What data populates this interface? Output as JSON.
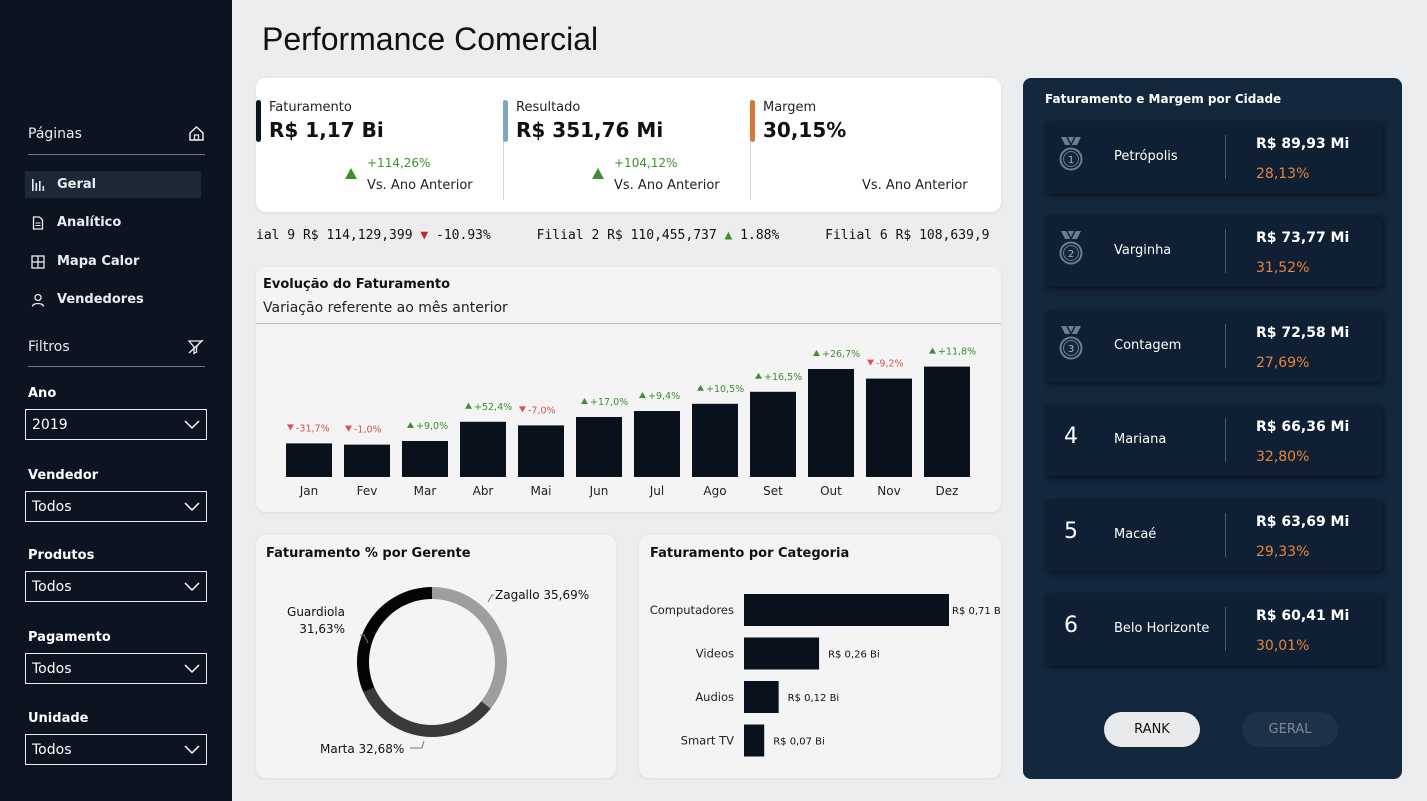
{
  "sidebar": {
    "pages_label": "Páginas",
    "nav": [
      {
        "label": "Geral",
        "icon": "bar-chart-icon"
      },
      {
        "label": "Analítico",
        "icon": "document-icon"
      },
      {
        "label": "Mapa Calor",
        "icon": "grid-icon"
      },
      {
        "label": "Vendedores",
        "icon": "person-icon"
      }
    ],
    "filters_label": "Filtros",
    "filters": [
      {
        "label": "Ano",
        "value": "2019"
      },
      {
        "label": "Vendedor",
        "value": "Todos"
      },
      {
        "label": "Produtos",
        "value": "Todos"
      },
      {
        "label": "Pagamento",
        "value": "Todos"
      },
      {
        "label": "Unidade",
        "value": "Todos"
      }
    ]
  },
  "header": {
    "title": "Performance Comercial"
  },
  "kpis": [
    {
      "label": "Faturamento",
      "value": "R$ 1,17 Bi",
      "change": "+114,26%",
      "compare": "Vs. Ano Anterior",
      "color": "#0b1420"
    },
    {
      "label": "Resultado",
      "value": "R$ 351,76 Mi",
      "change": "+104,12%",
      "compare": "Vs. Ano Anterior",
      "color": "#7ea6bd"
    },
    {
      "label": "Margem",
      "value": "30,15%",
      "change": "",
      "compare": "Vs. Ano Anterior",
      "color": "#d9773a"
    }
  ],
  "ticker": [
    {
      "name": "ial 9",
      "value": "R$ 114,129,399",
      "dir": "▼",
      "change": "-10.93%"
    },
    {
      "name": "Filial 2",
      "value": "R$ 110,455,737",
      "dir": "▲",
      "change": "1.88%"
    },
    {
      "name": "Filial 6",
      "value": "R$ 108,639,9",
      "dir": "",
      "change": ""
    }
  ],
  "evolution": {
    "title": "Evolução do Faturamento",
    "subtitle": "Variação referente ao mês anterior"
  },
  "donut": {
    "title": "Faturamento % por Gerente"
  },
  "category": {
    "title": "Faturamento por Categoria"
  },
  "chart_data": [
    {
      "type": "bar",
      "title": "Evolução do Faturamento",
      "categories": [
        "Jan",
        "Fev",
        "Mar",
        "Abr",
        "Mai",
        "Jun",
        "Jul",
        "Ago",
        "Set",
        "Out",
        "Nov",
        "Dez"
      ],
      "values": [
        28,
        27,
        30,
        46,
        43,
        50,
        55,
        61,
        71,
        90,
        82,
        92
      ],
      "variation_labels": [
        "-31,7%",
        "-1,0%",
        "+9,0%",
        "+52,4%",
        "-7,0%",
        "+17,0%",
        "+9,4%",
        "+10,5%",
        "+16,5%",
        "+26,7%",
        "-9,2%",
        "+11,8%"
      ],
      "up_color": "#3f8f2e",
      "down_color": "#d9534f",
      "bar_color": "#08111c"
    },
    {
      "type": "pie",
      "title": "Faturamento % por Gerente",
      "series": [
        {
          "name": "Zagallo",
          "label": "Zagallo 35,69%",
          "value": 35.69,
          "color": "#9e9e9e"
        },
        {
          "name": "Marta",
          "label": "Marta 32,68%",
          "value": 32.68,
          "color": "#3a3a3a"
        },
        {
          "name": "Guardiola",
          "label": "Guardiola 31,63%",
          "value": 31.63,
          "color": "#050505"
        }
      ]
    },
    {
      "type": "bar",
      "title": "Faturamento por Categoria",
      "categories": [
        "Computadores",
        "Videos",
        "Audios",
        "Smart TV"
      ],
      "values": [
        0.71,
        0.26,
        0.12,
        0.07
      ],
      "value_labels": [
        "R$ 0,71 Bi",
        "R$ 0,26 Bi",
        "R$ 0,12 Bi",
        "R$ 0,07 Bi"
      ],
      "bar_color": "#08111c"
    }
  ],
  "ranking": {
    "title": "Faturamento e Margem por Cidade",
    "items": [
      {
        "pos": "1",
        "city": "Petrópolis",
        "value": "R$ 89,93 Mi",
        "margin": "28,13%",
        "medal": true
      },
      {
        "pos": "2",
        "city": "Varginha",
        "value": "R$ 73,77 Mi",
        "margin": "31,52%",
        "medal": true
      },
      {
        "pos": "3",
        "city": "Contagem",
        "value": "R$ 72,58 Mi",
        "margin": "27,69%",
        "medal": true
      },
      {
        "pos": "4",
        "city": "Mariana",
        "value": "R$ 66,36 Mi",
        "margin": "32,80%",
        "medal": false
      },
      {
        "pos": "5",
        "city": "Macaé",
        "value": "R$ 63,69 Mi",
        "margin": "29,33%",
        "medal": false
      },
      {
        "pos": "6",
        "city": "Belo Horizonte",
        "value": "R$ 60,41 Mi",
        "margin": "30,01%",
        "medal": false
      }
    ],
    "buttons": {
      "rank": "RANK",
      "geral": "GERAL"
    }
  }
}
